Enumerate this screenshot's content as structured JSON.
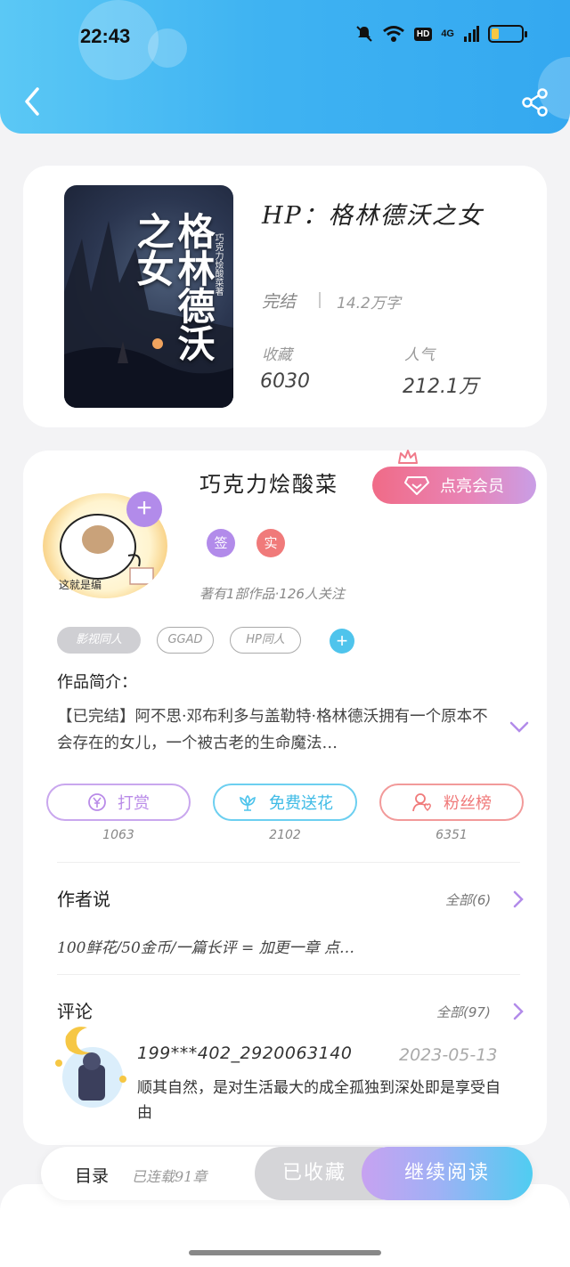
{
  "status_bar": {
    "time": "22:43",
    "hd": "HD",
    "network": "4G",
    "battery_level": 0.22,
    "battery_color": "#f6c744"
  },
  "header": {
    "back_icon": "chevron-left-icon",
    "share_icon": "share-icon",
    "accent": "#3fb3f2"
  },
  "book": {
    "title": "HP：格林德沃之女",
    "cover_title": "格林德沃之女",
    "cover_author": "巧克力烩酸菜著",
    "status": "完结",
    "word_count": "14.2万字",
    "favorites_label": "收藏",
    "favorites_value": "6030",
    "popularity_label": "人气",
    "popularity_value": "212.1万"
  },
  "author": {
    "name": "巧克力烩酸菜",
    "vip_button": "点亮会员",
    "badges": [
      {
        "label": "签",
        "color": "#b28bea"
      },
      {
        "label": "实",
        "color": "#f07a7a"
      }
    ],
    "meta": "著有1部作品·126人关注",
    "avatar_caption": "这就是编",
    "tags": [
      "影视同人",
      "GGAD",
      "HP同人"
    ]
  },
  "intro": {
    "label": "作品简介：",
    "text": "【已完结】阿不思·邓布利多与盖勒特·格林德沃拥有一个原本不会存在的女儿，一个被古老的生命魔法…"
  },
  "actions": [
    {
      "label": "打赏",
      "count": "1063",
      "color": "#b98be8",
      "icon": "yen-icon"
    },
    {
      "label": "免费送花",
      "count": "2102",
      "color": "#4fc4ec",
      "icon": "flower-icon"
    },
    {
      "label": "粉丝榜",
      "count": "6351",
      "color": "#f07a7a",
      "icon": "fan-icon"
    }
  ],
  "author_say": {
    "title": "作者说",
    "more": "全部(6)",
    "text": "100鲜花/50金币/一篇长评 = 加更一章 点…"
  },
  "comments": {
    "title": "评论",
    "more": "全部(97)",
    "items": [
      {
        "user": "199***402_2920063140",
        "date": "2023-05-13",
        "text": "顺其自然，是对生活最大的成全孤独到深处即是享受自由"
      }
    ]
  },
  "bottom_bar": {
    "toc_label": "目录",
    "toc_count": "已连载91章",
    "collected_label": "已收藏",
    "read_label": "继续阅读"
  }
}
